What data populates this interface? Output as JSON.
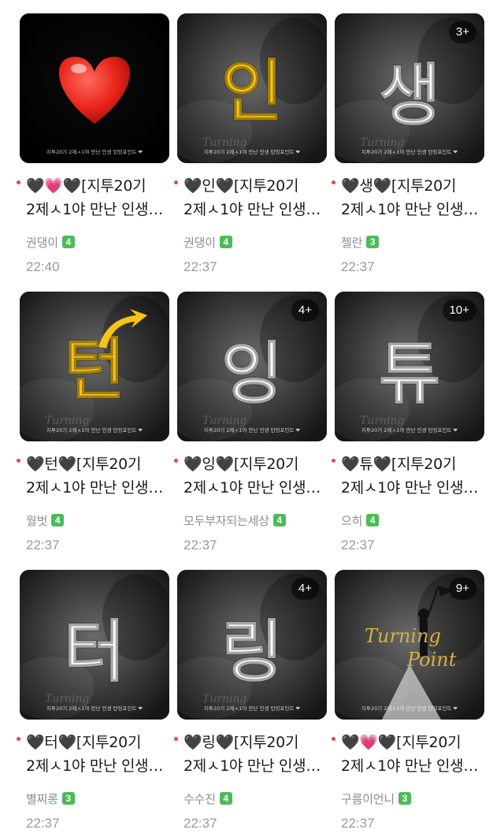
{
  "posts": [
    {
      "title_prefix": "🖤💗🖤",
      "title_text": "[지투20기",
      "title_line2": "2제ㅅ1야 만난 인생…",
      "author": "권댕이",
      "level": "4",
      "time": "22:40",
      "count": "",
      "glyph": "",
      "theme": "heart"
    },
    {
      "title_prefix": "🖤인🖤",
      "title_text": "[지투20기",
      "title_line2": "2제ㅅ1야 만난 인생…",
      "author": "권댕이",
      "level": "4",
      "time": "22:37",
      "count": "",
      "glyph": "인",
      "theme": "yellow"
    },
    {
      "title_prefix": "🖤생🖤",
      "title_text": "[지투20기",
      "title_line2": "2제ㅅ1야 만난 인생…",
      "author": "젤란",
      "level": "3",
      "time": "22:37",
      "count": "3+",
      "glyph": "생",
      "theme": "white"
    },
    {
      "title_prefix": "🖤턴🖤",
      "title_text": "[지투20기",
      "title_line2": "2제ㅅ1야 만난 인생…",
      "author": "월벗",
      "level": "4",
      "time": "22:37",
      "count": "",
      "glyph": "턴",
      "theme": "yellow-arrow"
    },
    {
      "title_prefix": "🖤잉🖤",
      "title_text": "[지투20기",
      "title_line2": "2제ㅅ1야 만난 인생…",
      "author": "모두부자되는세상",
      "level": "4",
      "time": "22:37",
      "count": "4+",
      "glyph": "잉",
      "theme": "white"
    },
    {
      "title_prefix": "🖤튜🖤",
      "title_text": "[지투20기",
      "title_line2": "2제ㅅ1야 만난 인생…",
      "author": "으히",
      "level": "4",
      "time": "22:37",
      "count": "10+",
      "glyph": "튜",
      "theme": "white"
    },
    {
      "title_prefix": "🖤터🖤",
      "title_text": "[지투20기",
      "title_line2": "2제ㅅ1야 만난 인생…",
      "author": "별찌롱",
      "level": "3",
      "time": "22:37",
      "count": "",
      "glyph": "터",
      "theme": "white"
    },
    {
      "title_prefix": "🖤링🖤",
      "title_text": "[지투20기",
      "title_line2": "2제ㅅ1야 만난 인생…",
      "author": "수수진",
      "level": "4",
      "time": "22:37",
      "count": "4+",
      "glyph": "링",
      "theme": "white"
    },
    {
      "title_prefix": "🖤💗🖤",
      "title_text": "[지투20기",
      "title_line2": "2제ㅅ1야 만난 인생…",
      "author": "구름이언니",
      "level": "3",
      "time": "22:37",
      "count": "9+",
      "glyph": "",
      "theme": "point"
    }
  ],
  "thumb_caption": "지투20기 2제ㅅ1야 만난 인생 턴잉포인트 ❤",
  "thumb_script": "Turning",
  "thumb_script2": "Point",
  "colors": {
    "accent_dot": "#e9493f",
    "level_badge": "#4dbb57",
    "glyph_yellow": "#f7c415"
  }
}
